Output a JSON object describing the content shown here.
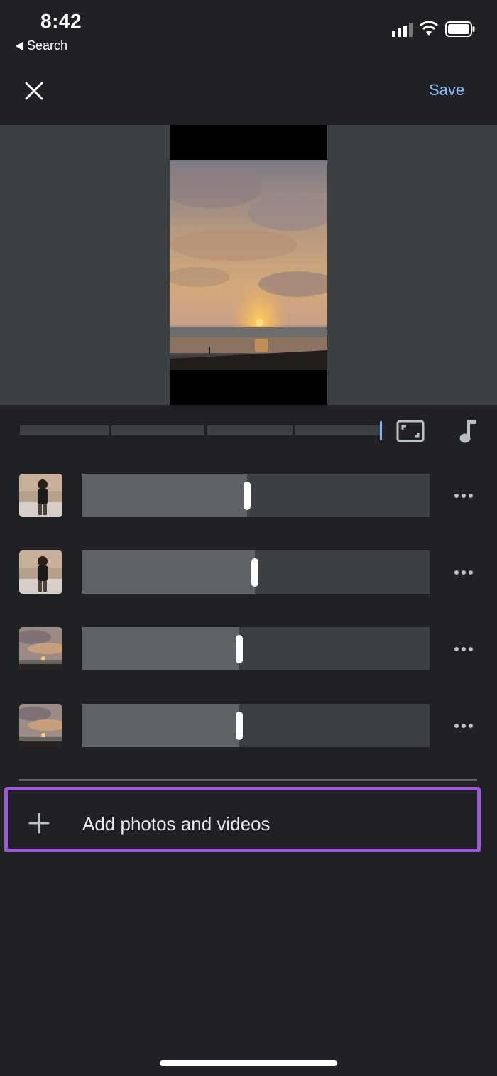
{
  "status_bar": {
    "time": "8:42",
    "back_label": "Search",
    "icons": [
      "cellular-signal-icon",
      "wifi-icon",
      "battery-icon"
    ]
  },
  "toolbar": {
    "close_icon": "close-icon",
    "save_label": "Save"
  },
  "colors": {
    "background": "#202124",
    "accent": "#8ab4f8",
    "highlight_border": "#9b59d4"
  },
  "preview": {
    "scene": "sunset over beach"
  },
  "timeline": {
    "controls": [
      "aspect-ratio-icon",
      "music-note-icon"
    ]
  },
  "clips": [
    {
      "thumbnail": "child-portrait",
      "trim_position": 0.476
    },
    {
      "thumbnail": "child-portrait",
      "trim_position": 0.498
    },
    {
      "thumbnail": "sunset-beach",
      "trim_position": 0.453
    },
    {
      "thumbnail": "sunset-beach",
      "trim_position": 0.453
    }
  ],
  "add_media": {
    "label": "Add photos and videos",
    "icon": "plus-icon"
  }
}
